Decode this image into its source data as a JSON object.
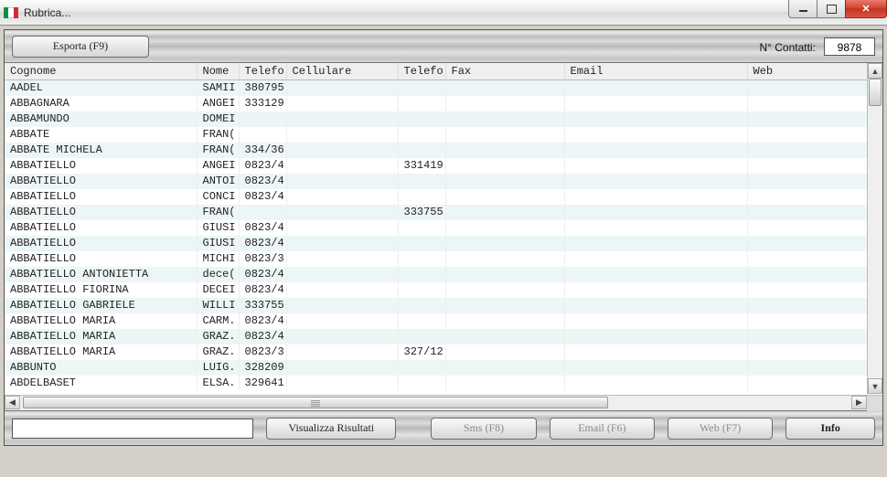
{
  "window": {
    "title": "Rubrica..."
  },
  "toolbar": {
    "export_label": "Esporta (F9)",
    "count_label": "N° Contatti:",
    "count_value": "9878"
  },
  "columns": {
    "cognome": "Cognome",
    "nome": "Nome",
    "telefono1": "Telefo",
    "cellulare": "Cellulare",
    "telefono2": "Telefo",
    "fax": "Fax",
    "email": "Email",
    "web": "Web"
  },
  "rows": [
    {
      "cognome": "AADEL",
      "nome": "SAMII",
      "tel1": "380795",
      "cell": "",
      "tel2": "",
      "fax": "",
      "email": "",
      "web": ""
    },
    {
      "cognome": "ABBAGNARA",
      "nome": "ANGEI",
      "tel1": "333129",
      "cell": "",
      "tel2": "",
      "fax": "",
      "email": "",
      "web": ""
    },
    {
      "cognome": "ABBAMUNDO",
      "nome": "DOMEI",
      "tel1": "",
      "cell": "",
      "tel2": "",
      "fax": "",
      "email": "",
      "web": ""
    },
    {
      "cognome": "ABBATE",
      "nome": "FRAN(",
      "tel1": "",
      "cell": "",
      "tel2": "",
      "fax": "",
      "email": "",
      "web": ""
    },
    {
      "cognome": "ABBATE MICHELA",
      "nome": "FRAN(",
      "tel1": "334/36",
      "cell": "",
      "tel2": "",
      "fax": "",
      "email": "",
      "web": ""
    },
    {
      "cognome": "ABBATIELLO",
      "nome": "ANGEI",
      "tel1": "0823/4",
      "cell": "",
      "tel2": "331419",
      "fax": "",
      "email": "",
      "web": ""
    },
    {
      "cognome": "ABBATIELLO",
      "nome": "ANTOI",
      "tel1": "0823/4",
      "cell": "",
      "tel2": "",
      "fax": "",
      "email": "",
      "web": ""
    },
    {
      "cognome": "ABBATIELLO",
      "nome": "CONCI",
      "tel1": "0823/4",
      "cell": "",
      "tel2": "",
      "fax": "",
      "email": "",
      "web": ""
    },
    {
      "cognome": "ABBATIELLO",
      "nome": "FRAN(",
      "tel1": "",
      "cell": "",
      "tel2": "333755",
      "fax": "",
      "email": "",
      "web": ""
    },
    {
      "cognome": "ABBATIELLO",
      "nome": "GIUSI",
      "tel1": "0823/4",
      "cell": "",
      "tel2": "",
      "fax": "",
      "email": "",
      "web": ""
    },
    {
      "cognome": "ABBATIELLO",
      "nome": "GIUSI",
      "tel1": "0823/4",
      "cell": "",
      "tel2": "",
      "fax": "",
      "email": "",
      "web": ""
    },
    {
      "cognome": "ABBATIELLO",
      "nome": "MICHI",
      "tel1": "0823/3",
      "cell": "",
      "tel2": "",
      "fax": "",
      "email": "",
      "web": ""
    },
    {
      "cognome": "ABBATIELLO ANTONIETTA",
      "nome": "dece(",
      "tel1": "0823/4",
      "cell": "",
      "tel2": "",
      "fax": "",
      "email": "",
      "web": ""
    },
    {
      "cognome": "ABBATIELLO FIORINA",
      "nome": "DECEI",
      "tel1": "0823/4",
      "cell": "",
      "tel2": "",
      "fax": "",
      "email": "",
      "web": ""
    },
    {
      "cognome": "ABBATIELLO GABRIELE",
      "nome": "WILLI",
      "tel1": "333755",
      "cell": "",
      "tel2": "",
      "fax": "",
      "email": "",
      "web": ""
    },
    {
      "cognome": "ABBATIELLO MARIA",
      "nome": "CARM.",
      "tel1": "0823/4",
      "cell": "",
      "tel2": "",
      "fax": "",
      "email": "",
      "web": ""
    },
    {
      "cognome": "ABBATIELLO MARIA",
      "nome": "GRAZ.",
      "tel1": "0823/4",
      "cell": "",
      "tel2": "",
      "fax": "",
      "email": "",
      "web": ""
    },
    {
      "cognome": "ABBATIELLO MARIA",
      "nome": "GRAZ.",
      "tel1": "0823/3",
      "cell": "",
      "tel2": "327/12",
      "fax": "",
      "email": "",
      "web": ""
    },
    {
      "cognome": "ABBUNTO",
      "nome": "LUIG.",
      "tel1": "328209",
      "cell": "",
      "tel2": "",
      "fax": "",
      "email": "",
      "web": ""
    },
    {
      "cognome": "ABDELBASET",
      "nome": "ELSA.",
      "tel1": "329641",
      "cell": "",
      "tel2": "",
      "fax": "",
      "email": "",
      "web": ""
    }
  ],
  "bottombar": {
    "search_placeholder": "",
    "visualizza_label": "Visualizza Risultati",
    "sms_label": "Sms (F8)",
    "email_label": "Email (F6)",
    "web_label": "Web (F7)",
    "info_label": "Info"
  }
}
